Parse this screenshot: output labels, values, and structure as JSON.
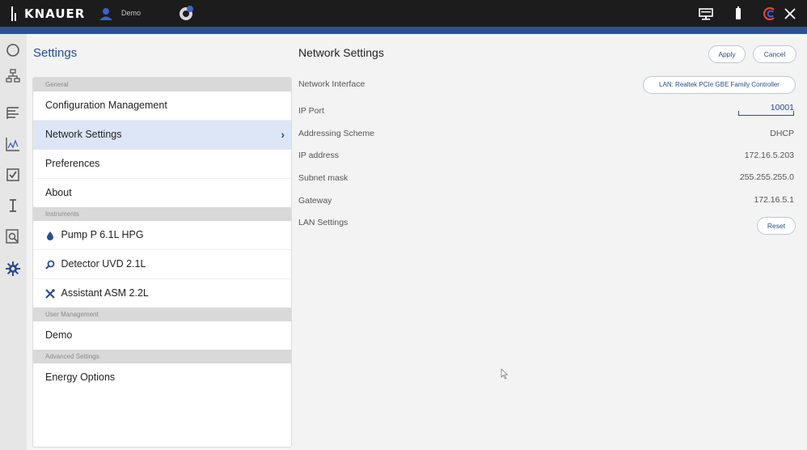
{
  "topbar": {
    "brand": "KNAUER",
    "user": "Demo"
  },
  "settings": {
    "title": "Settings",
    "sections": [
      {
        "header": "General",
        "items": [
          {
            "label": "Configuration Management"
          },
          {
            "label": "Network Settings",
            "active": true
          },
          {
            "label": "Preferences"
          },
          {
            "label": "About"
          }
        ]
      },
      {
        "header": "Instruments",
        "items": [
          {
            "label": "Pump P 6.1L HPG",
            "icon": "drop-icon"
          },
          {
            "label": "Detector UVD 2.1L",
            "icon": "magnifier-icon"
          },
          {
            "label": "Assistant ASM 2.2L",
            "icon": "tools-icon"
          }
        ]
      },
      {
        "header": "User Management",
        "items": [
          {
            "label": "Demo"
          }
        ]
      },
      {
        "header": "Advanced Settings",
        "items": [
          {
            "label": "Energy Options"
          }
        ]
      }
    ]
  },
  "network": {
    "title": "Network Settings",
    "apply": "Apply",
    "cancel": "Cancel",
    "interface_label": "Network Interface",
    "interface_value": "LAN: Realtek PCIe GBE Family Controller",
    "port_label": "IP Port",
    "port_value": "10001",
    "scheme_label": "Addressing Scheme",
    "scheme_value": "DHCP",
    "ip_label": "IP address",
    "ip_value": "172.16.5.203",
    "mask_label": "Subnet mask",
    "mask_value": "255.255.255.0",
    "gateway_label": "Gateway",
    "gateway_value": "172.16.5.1",
    "lan_label": "LAN Settings",
    "reset": "Reset"
  },
  "colors": {
    "accent": "#2e4f9a",
    "topbar": "#1c1c1c",
    "active": "#dde6f7"
  }
}
